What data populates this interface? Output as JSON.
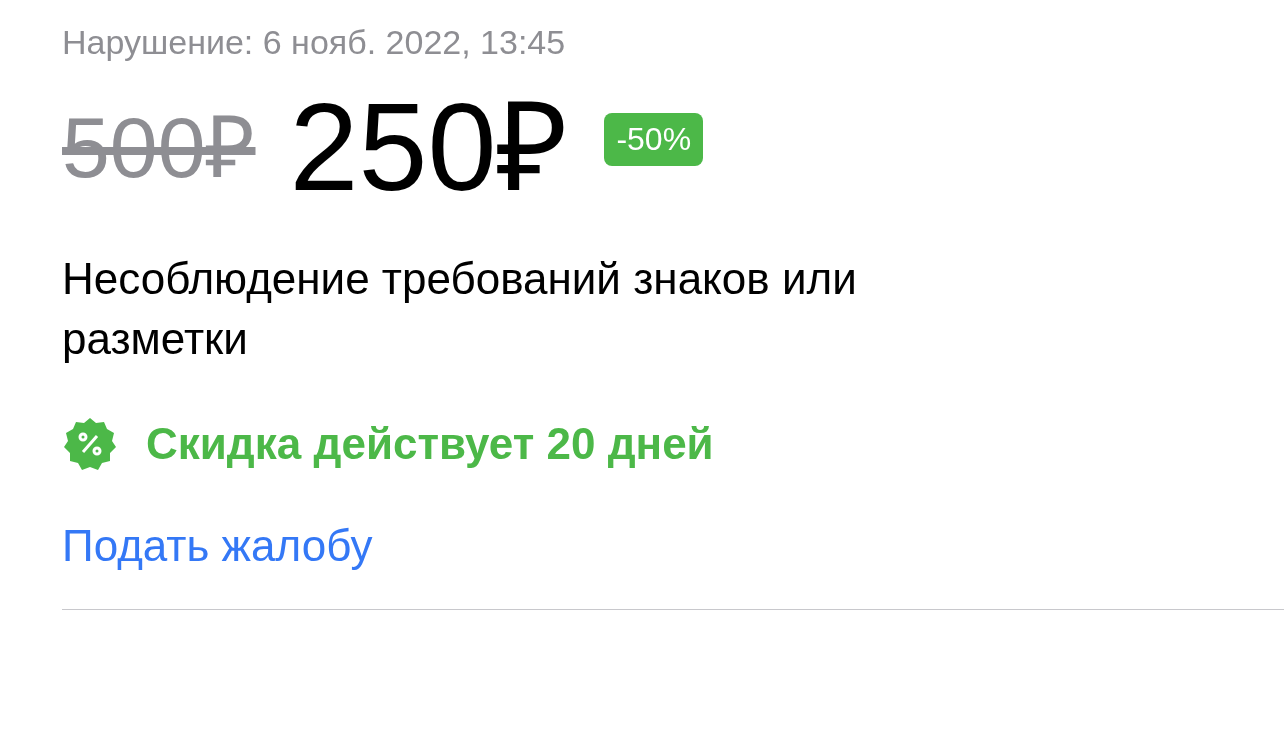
{
  "violation_date": "Нарушение: 6 нояб. 2022, 13:45",
  "price": {
    "old": "500₽",
    "current": "250₽",
    "discount_badge": "-50%"
  },
  "description": "Несоблюдение требований знаков или разметки",
  "discount_notice": {
    "text": "Скидка действует 20 дней"
  },
  "complaint_link": "Подать жалобу"
}
